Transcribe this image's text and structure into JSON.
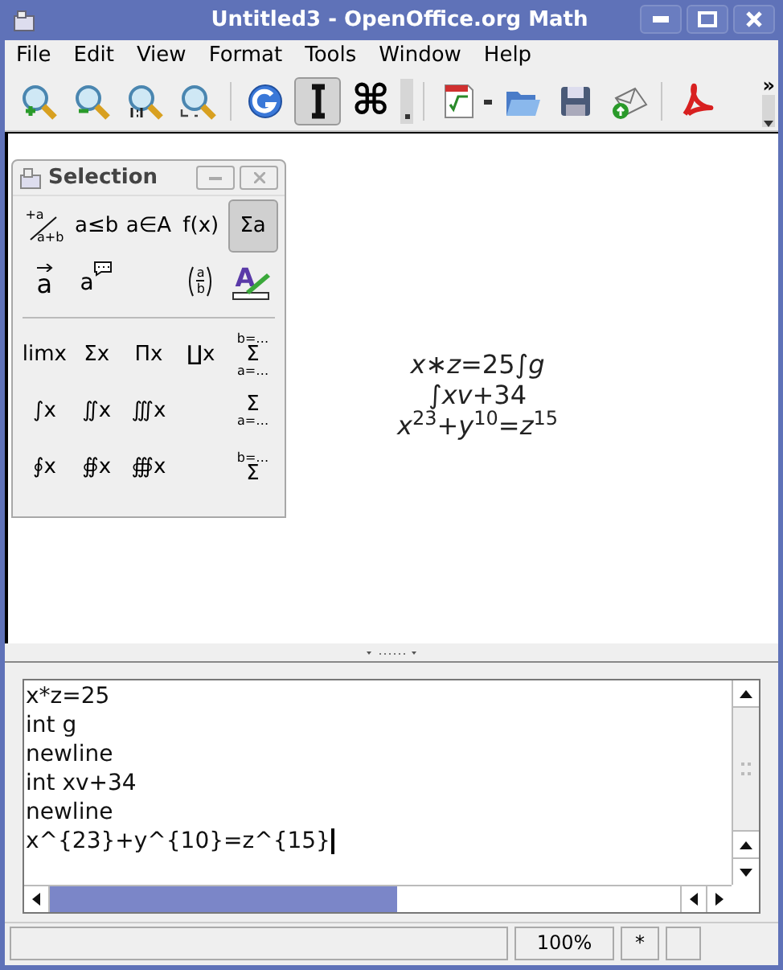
{
  "window": {
    "title": "Untitled3 - OpenOffice.org Math"
  },
  "menu": [
    {
      "label": "File"
    },
    {
      "label": "Edit"
    },
    {
      "label": "View"
    },
    {
      "label": "Format"
    },
    {
      "label": "Tools"
    },
    {
      "label": "Window"
    },
    {
      "label": "Help"
    }
  ],
  "toolbar": [
    {
      "kind": "zoom-in",
      "pressed": false
    },
    {
      "kind": "zoom-out",
      "pressed": false
    },
    {
      "kind": "zoom-100",
      "pressed": false
    },
    {
      "kind": "show-all",
      "pressed": false
    },
    {
      "kind": "separator"
    },
    {
      "kind": "update",
      "pressed": false
    },
    {
      "kind": "cursor",
      "pressed": true
    },
    {
      "kind": "symbols",
      "glyph": "⌘",
      "pressed": false
    },
    {
      "kind": "handle"
    },
    {
      "kind": "separator"
    },
    {
      "kind": "formula",
      "pressed": false
    },
    {
      "kind": "open",
      "pressed": false
    },
    {
      "kind": "save",
      "pressed": false
    },
    {
      "kind": "mail",
      "pressed": false
    },
    {
      "kind": "separator"
    },
    {
      "kind": "pdf",
      "pressed": false
    }
  ],
  "toolbar_overflow": "»",
  "selection_window": {
    "title": "Selection",
    "categories": [
      {
        "kind": "fraction",
        "top": "+a",
        "bottom": "a+b",
        "selected": false
      },
      {
        "kind": "glyph",
        "text": "a≤b",
        "selected": false
      },
      {
        "kind": "glyph",
        "text": "a∈A",
        "selected": false
      },
      {
        "kind": "glyph",
        "text": "f(x)",
        "selected": false
      },
      {
        "kind": "glyph",
        "text": "Σa",
        "selected": true
      },
      {
        "kind": "vector",
        "text": "a",
        "selected": false
      },
      {
        "kind": "annotation",
        "text": "a",
        "selected": false
      },
      {
        "kind": "gap"
      },
      {
        "kind": "brackets",
        "top": "a",
        "bottom": "b",
        "selected": false
      },
      {
        "kind": "format",
        "text": "A",
        "selected": false
      }
    ],
    "symbols": [
      {
        "kind": "glyph",
        "text": "limx"
      },
      {
        "kind": "glyph",
        "text": "Σx"
      },
      {
        "kind": "glyph",
        "text": "Πx"
      },
      {
        "kind": "glyph",
        "text": "∐x"
      },
      {
        "kind": "limits",
        "upper": "b=…",
        "symbol": "Σ",
        "lower": "a=…"
      },
      {
        "kind": "glyph",
        "text": "∫x"
      },
      {
        "kind": "glyph",
        "text": "∬x"
      },
      {
        "kind": "glyph",
        "text": "∭x"
      },
      {
        "kind": "gap"
      },
      {
        "kind": "limits",
        "symbol": "Σ",
        "lower": "a=…"
      },
      {
        "kind": "glyph",
        "text": "∮x"
      },
      {
        "kind": "glyph",
        "text": "∯x"
      },
      {
        "kind": "glyph",
        "text": "∰x"
      },
      {
        "kind": "gap"
      },
      {
        "kind": "limits",
        "upper": "b=…",
        "symbol": "Σ"
      }
    ]
  },
  "formula": [
    "*x*∗*z*=25∫*g*",
    "∫*xv*+34",
    "*x*$^{23}$+*y*$^{10}$=*z*$^{15}$"
  ],
  "editor": {
    "lines": [
      "x*z=25",
      "int g",
      "newline",
      "int xv+34",
      "newline",
      "x^{23}+y^{10}=z^{15}"
    ]
  },
  "status_bar": {
    "zoom": "100%",
    "modified": "*"
  }
}
